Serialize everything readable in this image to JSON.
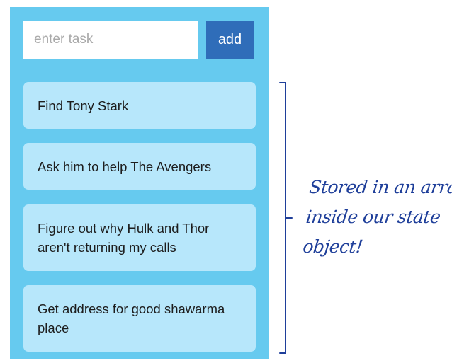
{
  "task_input": {
    "placeholder": "enter task",
    "value": ""
  },
  "add_button": {
    "label": "add"
  },
  "tasks": [
    {
      "label": "Find Tony Stark"
    },
    {
      "label": "Ask him to help The Avengers"
    },
    {
      "label": "Figure out why Hulk and Thor aren't returning my calls"
    },
    {
      "label": "Get address for good shawarma place"
    }
  ],
  "annotation": {
    "lines": [
      "Stored in an array",
      "inside our state",
      "object!"
    ]
  },
  "colors": {
    "panel": "#66caef",
    "task_card": "#b7e7fb",
    "button": "#2f6db9",
    "annotation_ink": "#1f3f9a"
  }
}
